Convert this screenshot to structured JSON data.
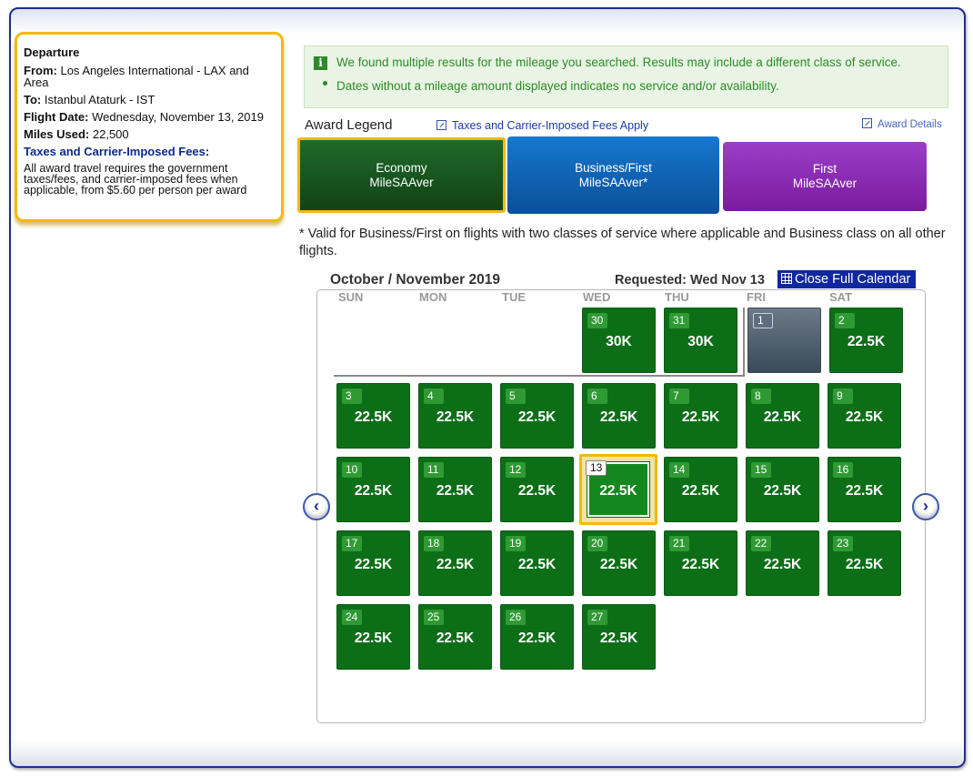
{
  "departure": {
    "title": "Departure",
    "from_label": "From:",
    "from_value": "Los Angeles International - LAX and Area",
    "to_label": "To:",
    "to_value": "Istanbul Ataturk - IST",
    "date_label": "Flight Date:",
    "date_value": "Wednesday, November 13, 2019",
    "miles_label": "Miles Used:",
    "miles_value": "22,500",
    "fees_title": "Taxes and Carrier-Imposed Fees",
    "fees_colon": ":",
    "fees_text": "All award travel requires the government taxes/fees, and carrier-imposed fees when applicable, from $5.60 per person per award"
  },
  "notice": {
    "line1": "We found multiple results for the mileage you searched. Results may include a different class of service.",
    "line2": "Dates without a mileage amount displayed indicates no service and/or availability."
  },
  "legend": {
    "label": "Award Legend",
    "taxes_link": "Taxes and Carrier-Imposed Fees Apply",
    "details_link": "Award Details",
    "economy_line1": "Economy",
    "economy_line2": "MileSAAver",
    "business_line1": "Business/First",
    "business_line2": "MileSAAver*",
    "first_line1": "First",
    "first_line2": "MileSAAver"
  },
  "valid_note": "* Valid for Business/First on flights with two classes of service where applicable and Business class on all other flights.",
  "calendar": {
    "month": "October / November 2019",
    "requested": "Requested: Wed Nov 13",
    "close_label": "Close Full Calendar",
    "dow": [
      "SUN",
      "MON",
      "TUE",
      "WED",
      "THU",
      "FRI",
      "SAT"
    ],
    "days": [
      {
        "day": "30",
        "miles": "30K"
      },
      {
        "day": "31",
        "miles": "30K"
      },
      {
        "day": "1",
        "miles": ""
      },
      {
        "day": "2",
        "miles": "22.5K"
      },
      {
        "day": "3",
        "miles": "22.5K"
      },
      {
        "day": "4",
        "miles": "22.5K"
      },
      {
        "day": "5",
        "miles": "22.5K"
      },
      {
        "day": "6",
        "miles": "22.5K"
      },
      {
        "day": "7",
        "miles": "22.5K"
      },
      {
        "day": "8",
        "miles": "22.5K"
      },
      {
        "day": "9",
        "miles": "22.5K"
      },
      {
        "day": "10",
        "miles": "22.5K"
      },
      {
        "day": "11",
        "miles": "22.5K"
      },
      {
        "day": "12",
        "miles": "22.5K"
      },
      {
        "day": "13",
        "miles": "22.5K"
      },
      {
        "day": "14",
        "miles": "22.5K"
      },
      {
        "day": "15",
        "miles": "22.5K"
      },
      {
        "day": "16",
        "miles": "22.5K"
      },
      {
        "day": "17",
        "miles": "22.5K"
      },
      {
        "day": "18",
        "miles": "22.5K"
      },
      {
        "day": "19",
        "miles": "22.5K"
      },
      {
        "day": "20",
        "miles": "22.5K"
      },
      {
        "day": "21",
        "miles": "22.5K"
      },
      {
        "day": "22",
        "miles": "22.5K"
      },
      {
        "day": "23",
        "miles": "22.5K"
      },
      {
        "day": "24",
        "miles": "22.5K"
      },
      {
        "day": "25",
        "miles": "22.5K"
      },
      {
        "day": "26",
        "miles": "22.5K"
      },
      {
        "day": "27",
        "miles": "22.5K"
      }
    ],
    "prev_arrow": "‹",
    "next_arrow": "›"
  },
  "colors": {
    "economy": "#124216",
    "business": "#0b4f98",
    "first": "#7a1a9f",
    "available": "#0d6e18",
    "selected_border": "#f2b90f",
    "notice_text": "#2d8a2a"
  }
}
